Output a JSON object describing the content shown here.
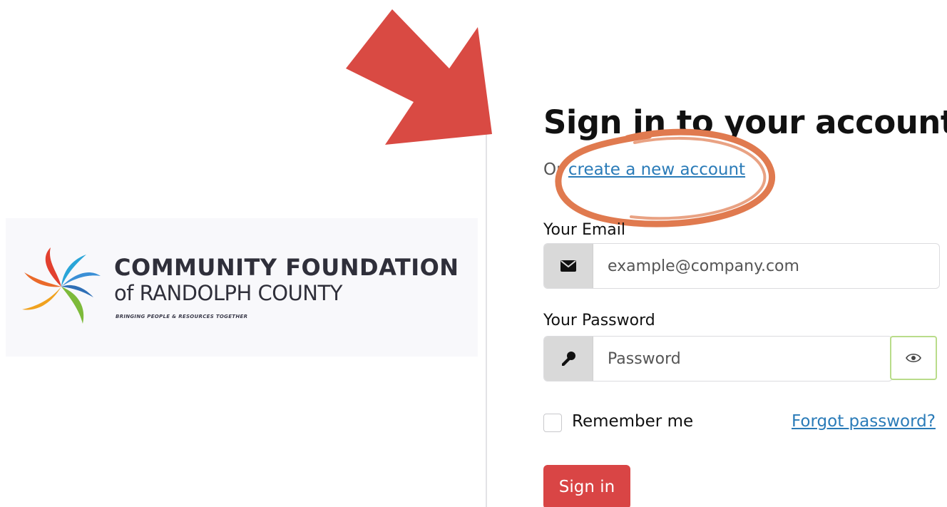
{
  "logo": {
    "title": "COMMUNITY FOUNDATION",
    "subtitle": "of RANDOLPH COUNTY",
    "tagline": "BRINGING PEOPLE & RESOURCES TOGETHER"
  },
  "form": {
    "title": "Sign in to your account",
    "create_prefix": "Or ",
    "create_link": "create a new account",
    "email_label": "Your Email",
    "email_placeholder": "example@company.com",
    "password_label": "Your Password",
    "password_placeholder": "Password",
    "remember_label": "Remember me",
    "forgot_link": "Forgot password?",
    "signin_label": "Sign in"
  },
  "icons": {
    "email": "envelope-icon",
    "password": "key-icon",
    "toggle": "eye-icon"
  },
  "colors": {
    "primary": "#d94545",
    "link": "#2a7bb8",
    "annotation_arrow": "#d94a43",
    "annotation_circle": "#e07a4f",
    "focus_border": "#b9dc8a"
  }
}
